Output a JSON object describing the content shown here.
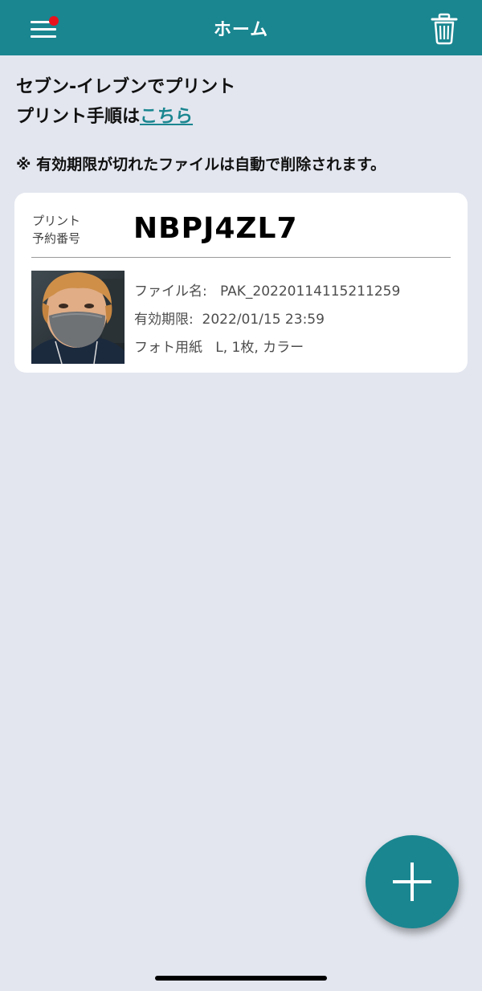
{
  "header": {
    "title": "ホーム",
    "menu_icon": "hamburger-menu-icon",
    "notification_color": "#e8121d",
    "trash_icon": "trash-icon",
    "bg_color": "#1a8690"
  },
  "info": {
    "line1": "セブン-イレブンでプリント",
    "line2_prefix": "プリント手順は",
    "line2_link": "こちら",
    "notice": "※ 有効期限が切れたファイルは自動で削除されます。"
  },
  "card": {
    "number_label_line1": "プリント",
    "number_label_line2": "予約番号",
    "number": "NBPJ4ZL7",
    "file_name_label": "ファイル名:",
    "file_name": "PAK_20220114115211259",
    "expiry_label": "有効期限:",
    "expiry": "2022/01/15 23:59",
    "paper_label": "フォト用紙",
    "paper": "L, 1枚, カラー"
  },
  "fab": {
    "icon": "plus-icon"
  }
}
